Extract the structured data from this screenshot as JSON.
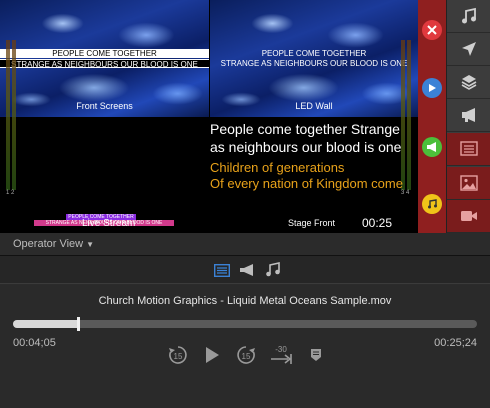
{
  "preview": {
    "front": {
      "line1": "PEOPLE COME TOGETHER",
      "line2": "STRANGE AS NEIGHBOURS OUR BLOOD IS ONE",
      "label": "Front Screens"
    },
    "led": {
      "line1": "PEOPLE COME TOGETHER",
      "line2": "STRANGE AS NEIGHBOURS OUR BLOOD IS ONE",
      "label": "LED Wall"
    },
    "meter_left_label": "1 2",
    "meter_right_label": "3 4",
    "stage": {
      "current": "People come together Strange as neighbours our blood is one",
      "next_line1": "Children of generations",
      "next_line2": "Of every nation of Kingdom come",
      "time": "00:25",
      "label": "Stage Front"
    },
    "stream": {
      "strip1": "PEOPLE COME TOGETHER",
      "strip2": "STRANGE AS NEIGHBOURS OUR BLOOD IS ONE",
      "label": "Live Stream"
    }
  },
  "operator": {
    "label": "Operator View"
  },
  "player": {
    "file": "Church Motion Graphics - Liquid Metal Oceans Sample.mov",
    "elapsed": "00:04;05",
    "remaining": "00:25;24",
    "progress": 0.14,
    "skip_back": "15",
    "skip_fwd": "15",
    "jump": "-30"
  },
  "colors": {
    "accent": "#3b82d6",
    "clear_red": "#e0393e",
    "play_blue": "#3b82d6",
    "announce_green": "#4cbf3a",
    "audio_yellow": "#f0c419",
    "side_red": "#8f1f1f"
  }
}
